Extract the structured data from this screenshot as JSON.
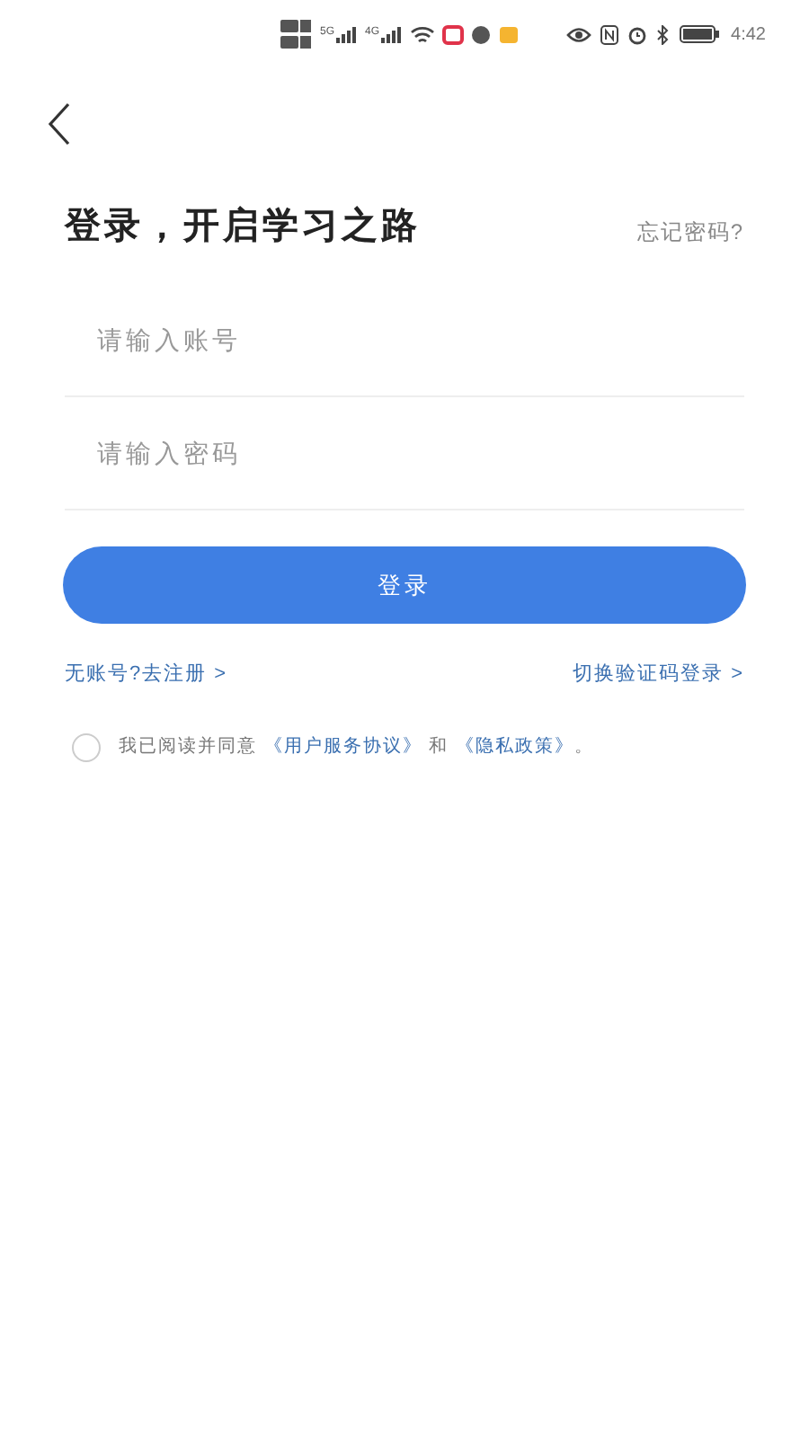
{
  "status_bar": {
    "signal_labels": [
      "5G",
      "4G"
    ],
    "time": "4:42"
  },
  "title": "登录，开启学习之路",
  "forgot_link": "忘记密码?",
  "fields": [
    {
      "placeholder": "请输入账号"
    },
    {
      "placeholder": "请输入密码"
    }
  ],
  "login_button": "登录",
  "register_link": "无账号?去注册 >",
  "switch_link": "切换验证码登录 >",
  "agreement": {
    "checked": false,
    "prefix": "我已阅读并同意 ",
    "terms_link": "《用户服务协议》",
    "middle": " 和 ",
    "privacy_link": "《隐私政策》",
    "suffix": "。"
  }
}
